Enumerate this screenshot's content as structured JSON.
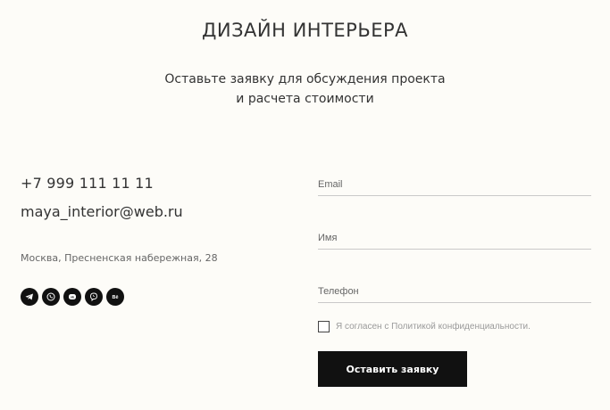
{
  "header": {
    "title": "ДИЗАЙН ИНТЕРЬЕРА",
    "subtitle_line1": "Оставьте заявку для обсуждения проекта",
    "subtitle_line2": "и расчета стоимости"
  },
  "contacts": {
    "phone": "+7 999 111 11 11",
    "email": "maya_interior@web.ru",
    "address": "Москва, Пресненская набережная, 28",
    "socials": [
      {
        "icon": "telegram-icon"
      },
      {
        "icon": "whatsapp-icon"
      },
      {
        "icon": "vk-icon"
      },
      {
        "icon": "viber-icon"
      },
      {
        "icon": "behance-icon",
        "label": "Bē"
      }
    ]
  },
  "form": {
    "email_placeholder": "Email",
    "name_placeholder": "Имя",
    "phone_placeholder": "Телефон",
    "consent_prefix": "Я согласен с ",
    "consent_link": "Политикой конфиденциальности.",
    "consent_checked": false,
    "submit_label": "Оставить заявку"
  },
  "colors": {
    "background": "#fdfcf8",
    "button": "#111111",
    "text": "#333333"
  }
}
